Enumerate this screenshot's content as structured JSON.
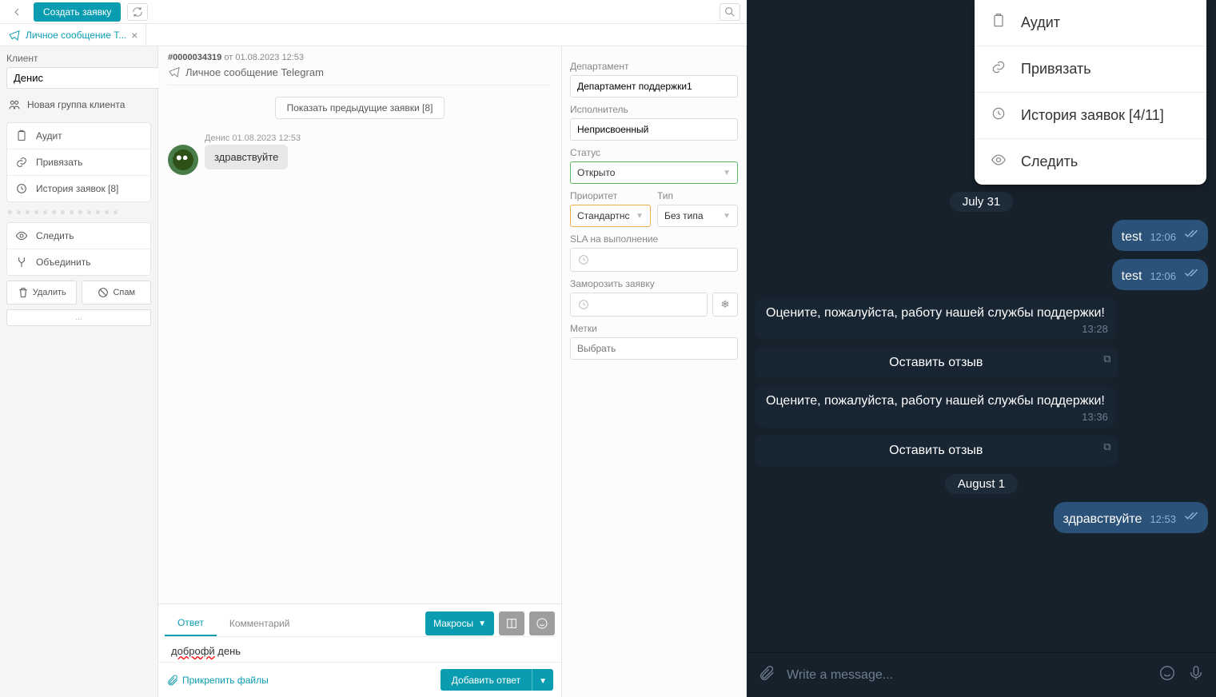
{
  "header": {
    "create_button": "Создать заявку"
  },
  "tab": {
    "title": "Личное сообщение Т..."
  },
  "sidebar": {
    "client_label": "Клиент",
    "client_value": "Денис",
    "group_label": "Новая группа клиента",
    "actions": {
      "audit": "Аудит",
      "bind": "Привязать",
      "history": "История заявок [8]",
      "follow": "Следить",
      "merge": "Объединить",
      "delete": "Удалить",
      "spam": "Спам",
      "more": "..."
    }
  },
  "ticket": {
    "id": "#0000034319",
    "date_prefix": "от",
    "date": "01.08.2023 12:53",
    "title": "Личное сообщение Telegram",
    "prev_button": "Показать предыдущие заявки [8]",
    "message_author": "Денис",
    "message_date": "01.08.2023 12:53",
    "message_text": "здравствуйте"
  },
  "reply": {
    "tab_reply": "Ответ",
    "tab_comment": "Комментарий",
    "macros": "Макросы",
    "text_err": "доброфй",
    "text_rest": " день",
    "attach": "Прикрепить файлы",
    "send": "Добавить ответ"
  },
  "panel": {
    "department_label": "Департамент",
    "department_value": "Департамент поддержки1",
    "assignee_label": "Исполнитель",
    "assignee_value": "Неприсвоенный",
    "status_label": "Статус",
    "status_value": "Открыто",
    "priority_label": "Приоритет",
    "priority_value": "Стандартнс",
    "type_label": "Тип",
    "type_value": "Без типа",
    "sla_label": "SLA на выполнение",
    "freeze_label": "Заморозить заявку",
    "tags_label": "Метки",
    "tags_placeholder": "Выбрать"
  },
  "telegram": {
    "popup": {
      "audit": "Аудит",
      "bind": "Привязать",
      "history": "История заявок [4/11]",
      "follow": "Следить"
    },
    "date1": "July 31",
    "date2": "August 1",
    "out1": {
      "text": "test",
      "time": "12:06"
    },
    "out2": {
      "text": "test",
      "time": "12:06"
    },
    "in1": {
      "text": "Оцените, пожалуйста, работу нашей службы поддержки!",
      "time": "13:28"
    },
    "btn1": "Оставить отзыв",
    "in2": {
      "text": "Оцените, пожалуйста, работу нашей службы поддержки!",
      "time": "13:36"
    },
    "btn2": "Оставить отзыв",
    "out3": {
      "text": "здравствуйте",
      "time": "12:53"
    },
    "input_placeholder": "Write a message..."
  }
}
